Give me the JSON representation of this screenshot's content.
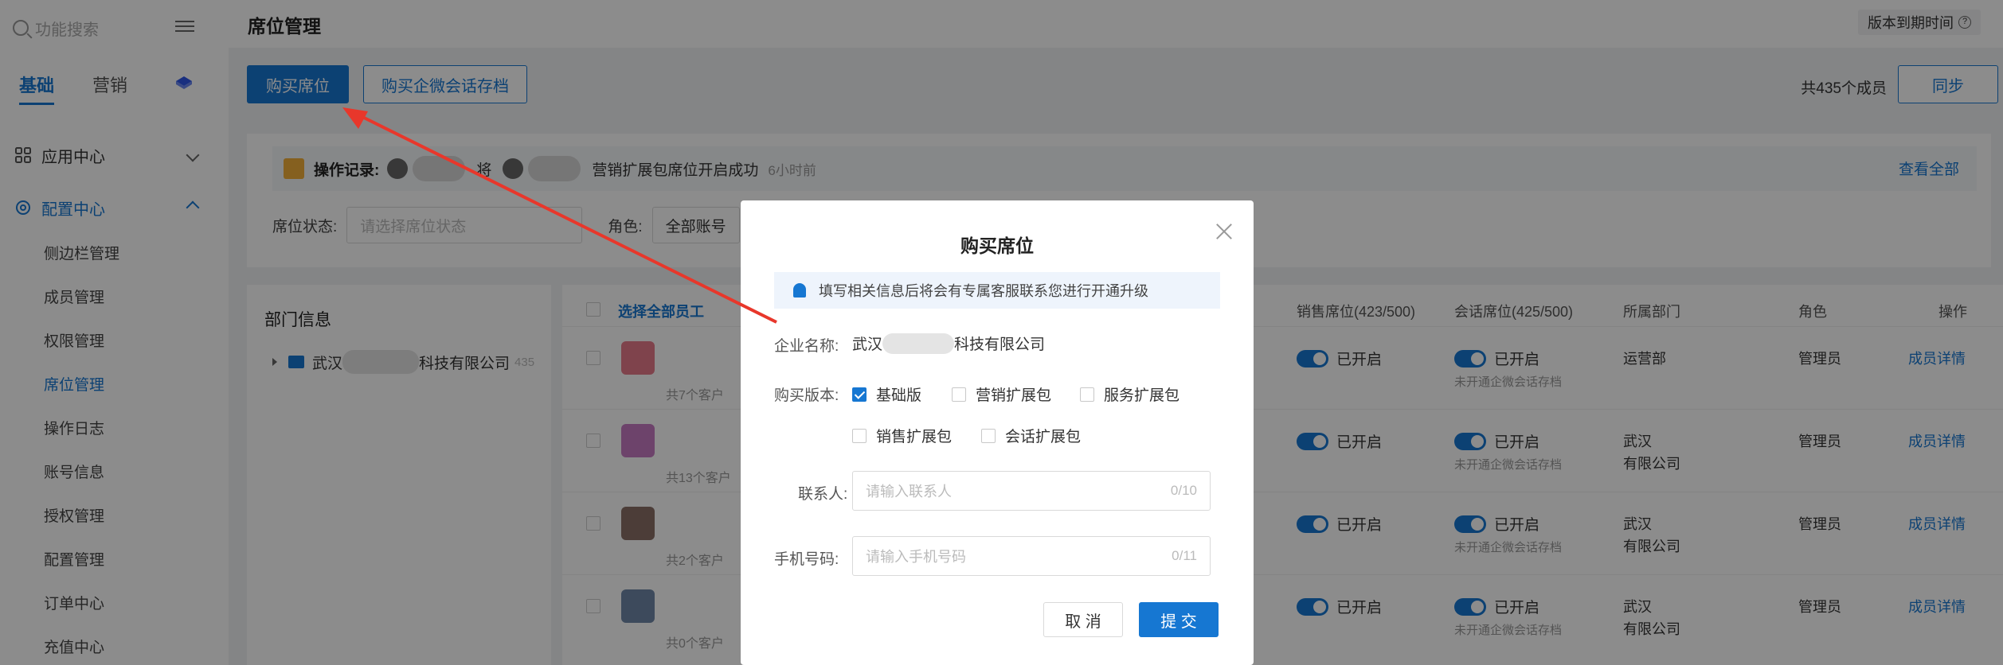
{
  "sidebar": {
    "search_placeholder": "功能搜索",
    "tabs": [
      "基础",
      "营销"
    ],
    "groups": [
      {
        "label": "应用中心"
      },
      {
        "label": "配置中心"
      }
    ],
    "submenu": [
      "侧边栏管理",
      "成员管理",
      "权限管理",
      "席位管理",
      "操作日志",
      "账号信息",
      "授权管理",
      "配置管理",
      "订单中心",
      "充值中心"
    ]
  },
  "header": {
    "title": "席位管理",
    "version_label": "版本到期时间",
    "version_help": "?"
  },
  "toolbar": {
    "buy_seat": "购买席位",
    "buy_archive": "购买企微会话存档",
    "member_count": "共435个成员",
    "sync": "同步"
  },
  "oplog": {
    "label": "操作记录:",
    "verb": "将",
    "message": "营销扩展包席位开启成功",
    "time": "6小时前",
    "view_all": "查看全部"
  },
  "filters": {
    "seat_status_label": "席位状态:",
    "seat_status_placeholder": "请选择席位状态",
    "role_label": "角色:",
    "role_value": "全部账号"
  },
  "dept": {
    "title": "部门信息",
    "company_prefix": "武汉",
    "company_suffix": "科技有限公司",
    "count": "435"
  },
  "table": {
    "select_all": "选择全部员工",
    "headers": {
      "sales_seat": "销售席位(423/500)",
      "chat_seat": "会话席位(425/500)",
      "dept": "所属部门",
      "role": "角色",
      "action": "操作"
    },
    "rows": [
      {
        "customers": "共7个客户",
        "sales": "已开启",
        "chat": "已开启",
        "chat_note": "未开通企微会话存档",
        "dept": "运营部",
        "dept2": "",
        "role": "管理员",
        "action": "成员详情"
      },
      {
        "customers": "共13个客户",
        "sales": "已开启",
        "chat": "已开启",
        "chat_note": "未开通企微会话存档",
        "dept": "武汉",
        "dept2": "有限公司",
        "role": "管理员",
        "action": "成员详情"
      },
      {
        "customers": "共2个客户",
        "sales": "已开启",
        "chat": "已开启",
        "chat_note": "未开通企微会话存档",
        "dept": "武汉",
        "dept2": "有限公司",
        "role": "管理员",
        "action": "成员详情"
      },
      {
        "customers": "共0个客户",
        "sales": "已开启",
        "chat": "已开启",
        "chat_note": "未开通企微会话存档",
        "dept": "武汉",
        "dept2": "有限公司",
        "role": "管理员",
        "action": "成员详情"
      }
    ]
  },
  "modal": {
    "title": "购买席位",
    "notice": "填写相关信息后将会有专属客服联系您进行开通升级",
    "company_label": "企业名称:",
    "company_prefix": "武汉",
    "company_suffix": "科技有限公司",
    "version_label": "购买版本:",
    "options": [
      {
        "label": "基础版",
        "checked": true
      },
      {
        "label": "营销扩展包",
        "checked": false
      },
      {
        "label": "服务扩展包",
        "checked": false
      },
      {
        "label": "销售扩展包",
        "checked": false
      },
      {
        "label": "会话扩展包",
        "checked": false
      }
    ],
    "contact_label": "联系人:",
    "contact_placeholder": "请输入联系人",
    "contact_count": "0/10",
    "phone_label": "手机号码:",
    "phone_placeholder": "请输入手机号码",
    "phone_count": "0/11",
    "cancel": "取 消",
    "submit": "提 交"
  },
  "colors": {
    "primary": "#1677d2",
    "annotation_arrow": "#e8372b"
  }
}
